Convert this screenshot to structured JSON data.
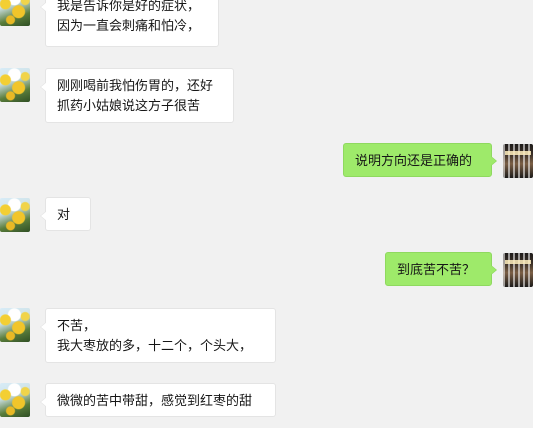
{
  "messages": [
    {
      "side": "left",
      "text": "我是告诉你是好的症状，\n因为一直会刺痛和怕冷，"
    },
    {
      "side": "left",
      "text": "刚刚喝前我怕伤胃的，还好\n抓药小姑娘说这方子很苦"
    },
    {
      "side": "right",
      "text": "说明方向还是正确的"
    },
    {
      "side": "left",
      "text": "对"
    },
    {
      "side": "right",
      "text": "到底苦不苦？"
    },
    {
      "side": "left",
      "text": "不苦，\n我大枣放的多，十二个，个头大，"
    },
    {
      "side": "left",
      "text": "微微的苦中带甜，感觉到红枣的甜"
    }
  ],
  "colors": {
    "background": "#f1f1f1",
    "left_bubble": "#ffffff",
    "right_bubble": "#9eea6a",
    "text": "#161616"
  },
  "icons": {
    "left_avatar": "sunflower-avatar-icon",
    "right_avatar": "shop-sign-avatar-icon"
  }
}
